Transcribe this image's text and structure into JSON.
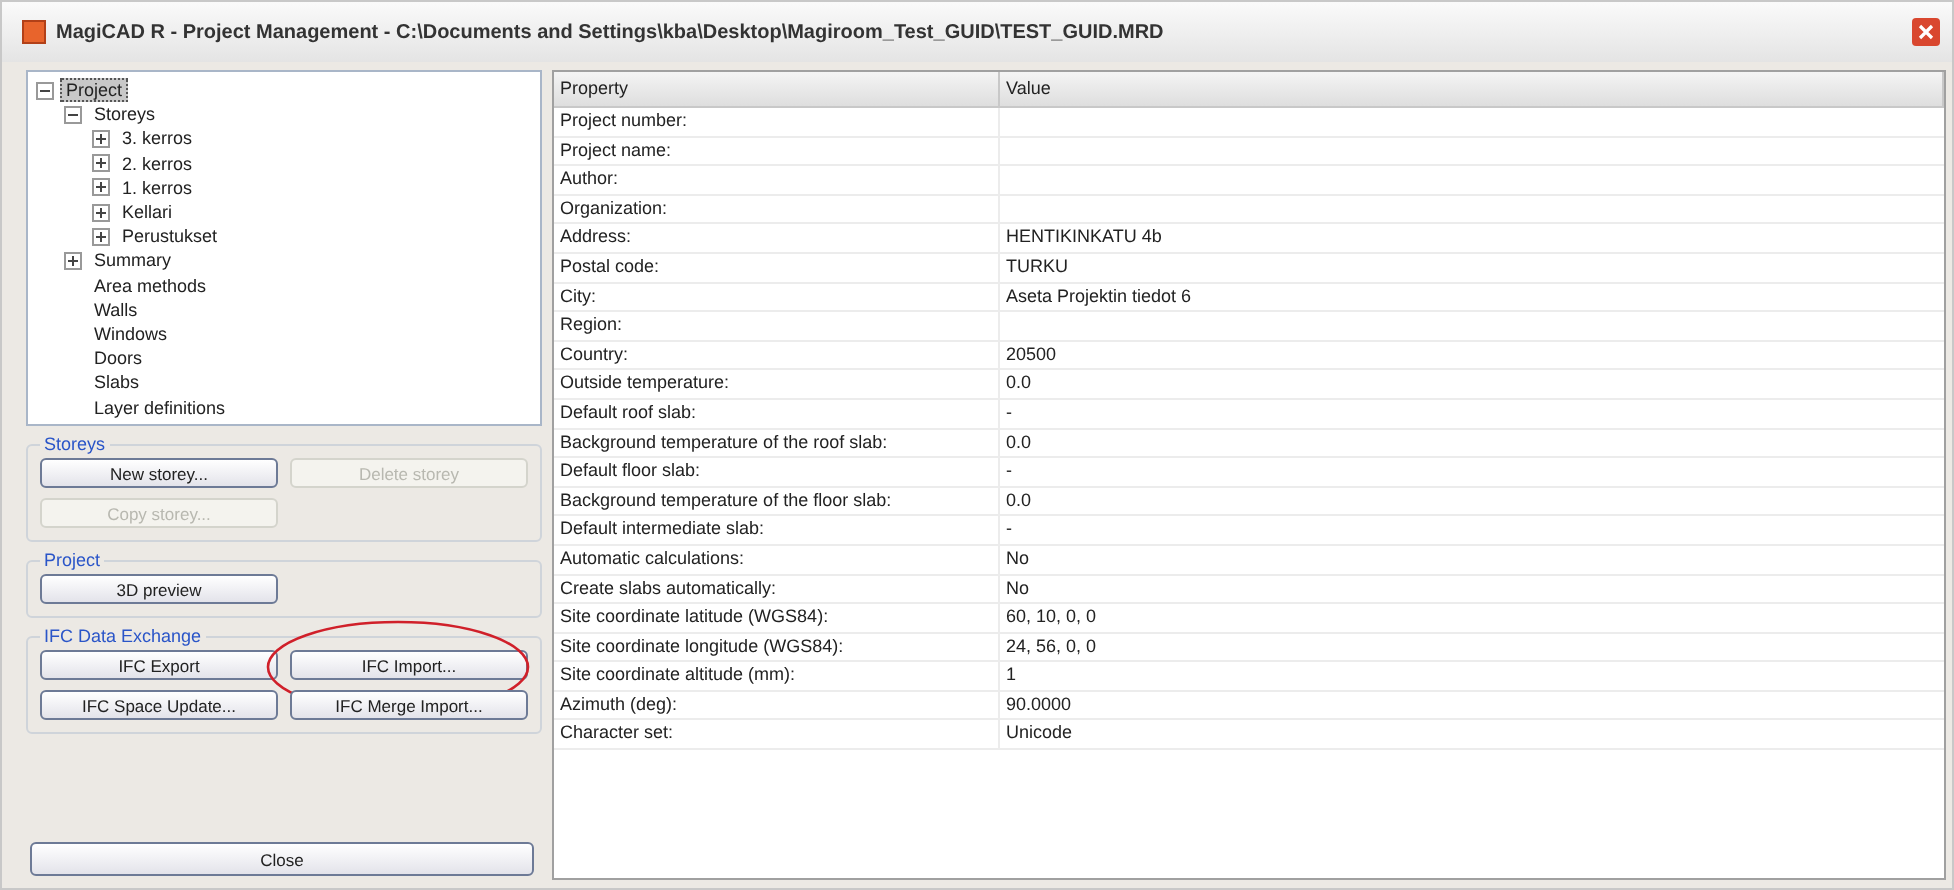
{
  "window": {
    "title": "MagiCAD R - Project Management - C:\\Documents and Settings\\kba\\Desktop\\Magiroom_Test_GUID\\TEST_GUID.MRD"
  },
  "tree": [
    {
      "label": "Project",
      "selected": true,
      "expanded": true,
      "children": [
        {
          "label": "Storeys",
          "selected": false,
          "expanded": true,
          "children": [
            {
              "label": "3. kerros",
              "selected": false,
              "expanded": false
            },
            {
              "label": "2. kerros",
              "selected": false,
              "expanded": false
            },
            {
              "label": "1. kerros",
              "selected": false,
              "expanded": false
            },
            {
              "label": "Kellari",
              "selected": false,
              "expanded": false
            },
            {
              "label": "Perustukset",
              "selected": false,
              "expanded": false
            }
          ]
        },
        {
          "label": "Summary",
          "selected": false,
          "expanded": false
        },
        {
          "label": "Area methods",
          "selected": false
        },
        {
          "label": "Walls",
          "selected": false
        },
        {
          "label": "Windows",
          "selected": false
        },
        {
          "label": "Doors",
          "selected": false
        },
        {
          "label": "Slabs",
          "selected": false
        },
        {
          "label": "Layer definitions",
          "selected": false
        }
      ]
    }
  ],
  "groups": [
    {
      "title": "Storeys",
      "buttons": [
        {
          "label": "New storey...",
          "disabled": false,
          "highlighted": false
        },
        {
          "label": "Delete storey",
          "disabled": true,
          "highlighted": false
        },
        {
          "label": "Copy storey...",
          "disabled": true,
          "highlighted": false
        }
      ]
    },
    {
      "title": "Project",
      "buttons": [
        {
          "label": "3D preview",
          "disabled": false,
          "highlighted": false
        }
      ]
    },
    {
      "title": "IFC Data Exchange",
      "buttons": [
        {
          "label": "IFC Export",
          "disabled": false,
          "highlighted": false
        },
        {
          "label": "IFC Import...",
          "disabled": false,
          "highlighted": true
        },
        {
          "label": "IFC Space Update...",
          "disabled": false,
          "highlighted": false
        },
        {
          "label": "IFC Merge Import...",
          "disabled": false,
          "highlighted": false
        }
      ]
    }
  ],
  "close_button": "Close",
  "table": {
    "columns": [
      "Property",
      "Value"
    ],
    "rows": [
      [
        "Project number:",
        ""
      ],
      [
        "Project name:",
        ""
      ],
      [
        "Author:",
        ""
      ],
      [
        "Organization:",
        ""
      ],
      [
        "Address:",
        "HENTIKINKATU 4b"
      ],
      [
        "Postal code:",
        "TURKU"
      ],
      [
        "City:",
        "Aseta Projektin tiedot 6"
      ],
      [
        "Region:",
        ""
      ],
      [
        "Country:",
        "20500"
      ],
      [
        "Outside temperature:",
        "0.0"
      ],
      [
        "Default roof slab:",
        "-"
      ],
      [
        "Background temperature of the roof slab:",
        "0.0"
      ],
      [
        "Default floor slab:",
        "-"
      ],
      [
        "Background temperature of the floor slab:",
        "0.0"
      ],
      [
        "Default intermediate slab:",
        "-"
      ],
      [
        "Automatic calculations:",
        "No"
      ],
      [
        "Create slabs automatically:",
        "No"
      ],
      [
        "Site coordinate latitude (WGS84):",
        "60, 10, 0, 0"
      ],
      [
        "Site coordinate longitude (WGS84):",
        "24, 56, 0, 0"
      ],
      [
        "Site coordinate altitude (mm):",
        "1"
      ],
      [
        "Azimuth (deg):",
        "90.0000"
      ],
      [
        "Character set:",
        "Unicode"
      ]
    ]
  }
}
